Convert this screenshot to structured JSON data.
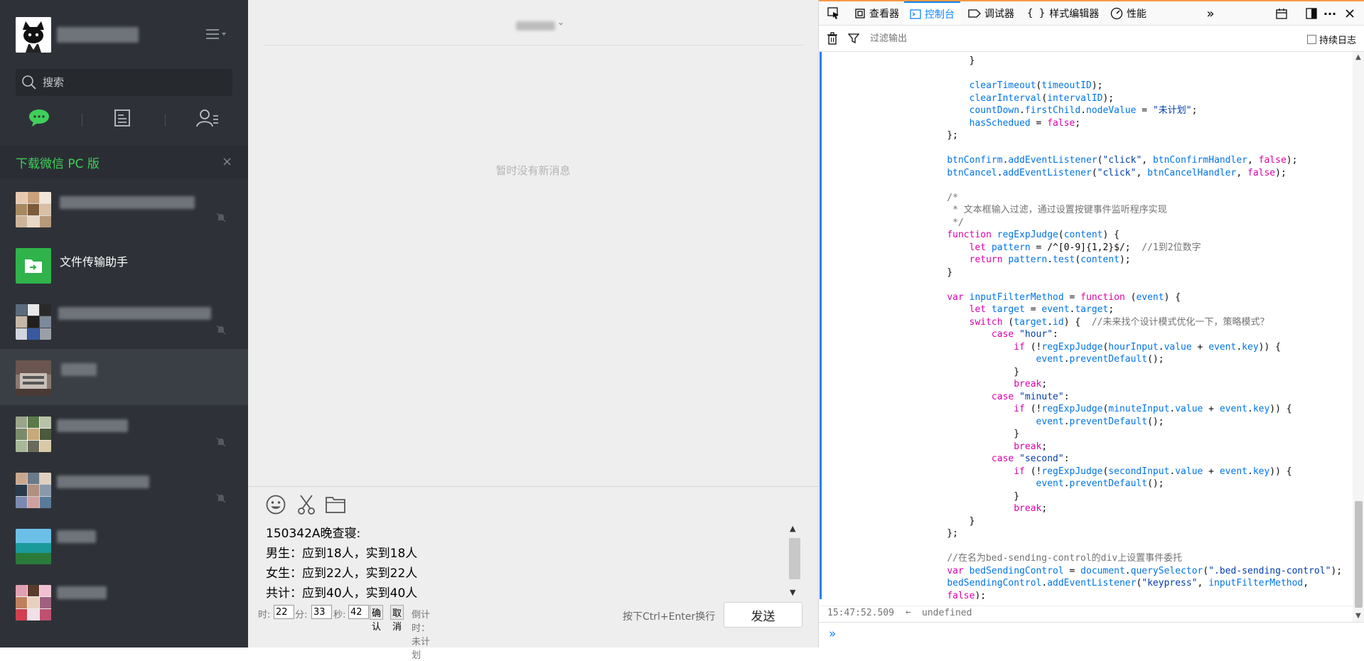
{
  "sidebar": {
    "search_placeholder": "搜索",
    "download_text": "下载微信 PC 版",
    "close_glyph": "×",
    "chats": [
      {
        "name": ""
      },
      {
        "name": "文件传输助手"
      },
      {
        "name": ""
      },
      {
        "name": ""
      },
      {
        "name": ""
      },
      {
        "name": ""
      },
      {
        "name": ""
      },
      {
        "name": ""
      }
    ]
  },
  "chat": {
    "no_messages": "暂时没有新消息",
    "composer_lines": [
      "150342A晚查寝:",
      "男生：应到18人，实到18人",
      "女生：应到22人，实到22人",
      "共计：应到40人，实到40人"
    ],
    "timer": {
      "hour_label": "时:",
      "hour_value": "22",
      "minute_label": "分:",
      "minute_value": "33",
      "second_label": "秒:",
      "second_value": "42",
      "confirm_label": "确认",
      "cancel_label": "取消",
      "countdown_label": "倒计时：未计划"
    },
    "send_hint": "按下Ctrl+Enter换行",
    "send_label": "发送"
  },
  "devtools": {
    "tabs": [
      {
        "label": "查看器"
      },
      {
        "label": "控制台"
      },
      {
        "label": "调试器"
      },
      {
        "label": "样式编辑器"
      },
      {
        "label": "性能"
      }
    ],
    "active_tab": "控制台",
    "more_tabs_glyph": "»",
    "filter_placeholder": "过滤输出",
    "persist_logs_label": "持续日志",
    "code_lines": [
      "        }",
      "",
      "        clearTimeout(timeoutID);",
      "        clearInterval(intervalID);",
      "        countDown.firstChild.nodeValue = \"未计划\";",
      "        hasSchedued = false;",
      "    };",
      "",
      "    btnConfirm.addEventListener(\"click\", btnConfirmHandler, false);",
      "    btnCancel.addEventListener(\"click\", btnCancelHandler, false);",
      "",
      "    /*",
      "     * 文本框输入过滤，通过设置按键事件监听程序实现",
      "     */",
      "    function regExpJudge(content) {",
      "        let pattern = /^[0-9]{1,2}$/;  //1到2位数字",
      "        return pattern.test(content);",
      "    }",
      "",
      "    var inputFilterMethod = function (event) {",
      "        let target = event.target;",
      "        switch (target.id) {  //未来找个设计模式优化一下，策略模式？",
      "            case \"hour\":",
      "                if (!regExpJudge(hourInput.value + event.key)) {",
      "                    event.preventDefault();",
      "                }",
      "                break;",
      "            case \"minute\":",
      "                if (!regExpJudge(minuteInput.value + event.key)) {",
      "                    event.preventDefault();",
      "                }",
      "                break;",
      "            case \"second\":",
      "                if (!regExpJudge(secondInput.value + event.key)) {",
      "                    event.preventDefault();",
      "                }",
      "                break;",
      "        }",
      "    };",
      "",
      "    //在名为bed-sending-control的div上设置事件委托",
      "    var bedSendingControl = document.querySelector(\".bed-sending-control\");",
      "    bedSendingControl.addEventListener(\"keypress\", inputFilterMethod,",
      "    false);"
    ],
    "result_timestamp": "15:47:52.509",
    "result_arrow": "←",
    "result_value": "undefined",
    "input_prompt": "»"
  },
  "colors": {
    "sidebar_bg": "#2e3238",
    "download_green": "#3fd05a",
    "chat_bg": "#eeeeee",
    "devtools_accent": "#0a84ff",
    "file_transfer_green": "#2fb34a"
  }
}
